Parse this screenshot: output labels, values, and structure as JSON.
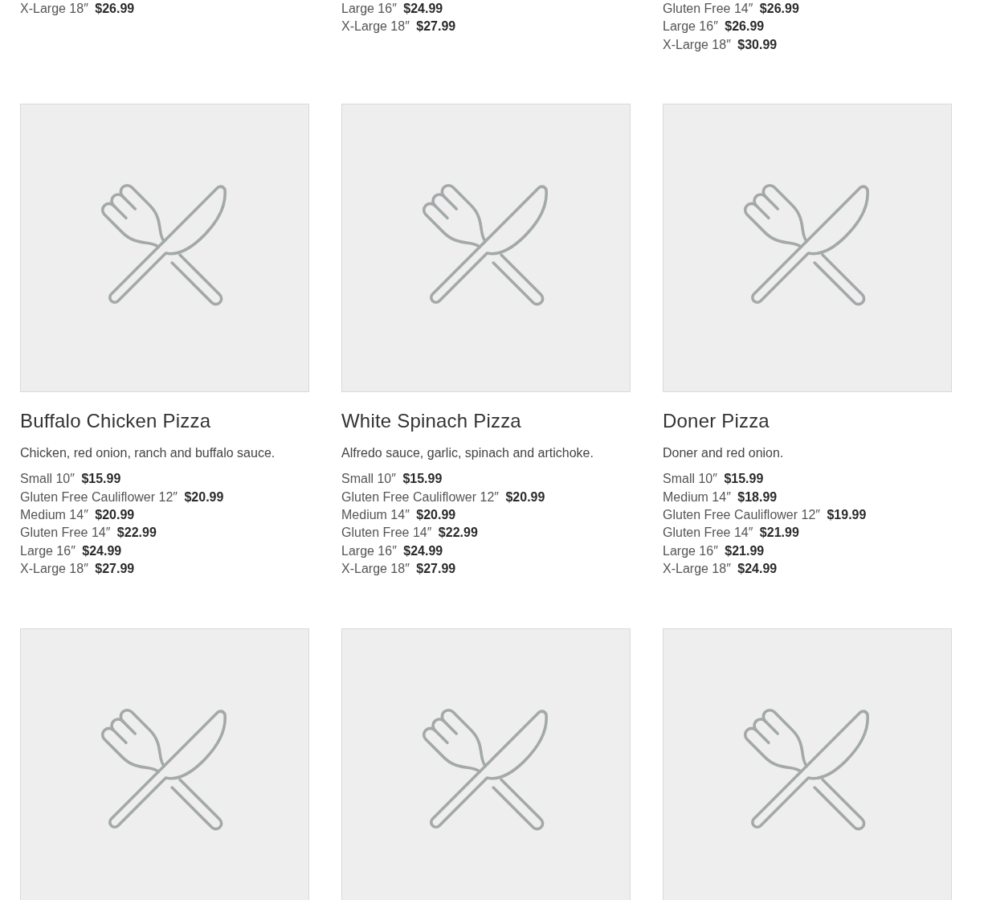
{
  "rows": [
    {
      "cards": [
        {
          "kind": "price-tail",
          "sizes": [
            {
              "size": "X-Large 18″",
              "price": "$26.99"
            }
          ]
        },
        {
          "kind": "price-tail",
          "sizes": [
            {
              "size": "Large 16″",
              "price": "$24.99"
            },
            {
              "size": "X-Large 18″",
              "price": "$27.99"
            }
          ]
        },
        {
          "kind": "price-tail",
          "sizes": [
            {
              "size": "Gluten Free 14″",
              "price": "$26.99"
            },
            {
              "size": "Large 16″",
              "price": "$26.99"
            },
            {
              "size": "X-Large 18″",
              "price": "$30.99"
            }
          ]
        }
      ]
    },
    {
      "cards": [
        {
          "kind": "full",
          "title": "Buffalo Chicken Pizza",
          "description": "Chicken, red onion, ranch and buffalo sauce.",
          "sizes": [
            {
              "size": "Small 10″",
              "price": "$15.99"
            },
            {
              "size": "Gluten Free Cauliflower 12″",
              "price": "$20.99"
            },
            {
              "size": "Medium 14″",
              "price": "$20.99"
            },
            {
              "size": "Gluten Free 14″",
              "price": "$22.99"
            },
            {
              "size": "Large 16″",
              "price": "$24.99"
            },
            {
              "size": "X-Large 18″",
              "price": "$27.99"
            }
          ]
        },
        {
          "kind": "full",
          "title": "White Spinach Pizza",
          "description": "Alfredo sauce, garlic, spinach and artichoke.",
          "sizes": [
            {
              "size": "Small 10″",
              "price": "$15.99"
            },
            {
              "size": "Gluten Free Cauliflower 12″",
              "price": "$20.99"
            },
            {
              "size": "Medium 14″",
              "price": "$20.99"
            },
            {
              "size": "Gluten Free 14″",
              "price": "$22.99"
            },
            {
              "size": "Large 16″",
              "price": "$24.99"
            },
            {
              "size": "X-Large 18″",
              "price": "$27.99"
            }
          ]
        },
        {
          "kind": "full",
          "title": "Doner Pizza",
          "description": "Doner and red onion.",
          "sizes": [
            {
              "size": "Small 10″",
              "price": "$15.99"
            },
            {
              "size": "Medium 14″",
              "price": "$18.99"
            },
            {
              "size": "Gluten Free Cauliflower 12″",
              "price": "$19.99"
            },
            {
              "size": "Gluten Free 14″",
              "price": "$21.99"
            },
            {
              "size": "Large 16″",
              "price": "$21.99"
            },
            {
              "size": "X-Large 18″",
              "price": "$24.99"
            }
          ]
        }
      ]
    },
    {
      "cards": [
        {
          "kind": "image-only"
        },
        {
          "kind": "image-only"
        },
        {
          "kind": "image-only"
        }
      ]
    }
  ]
}
